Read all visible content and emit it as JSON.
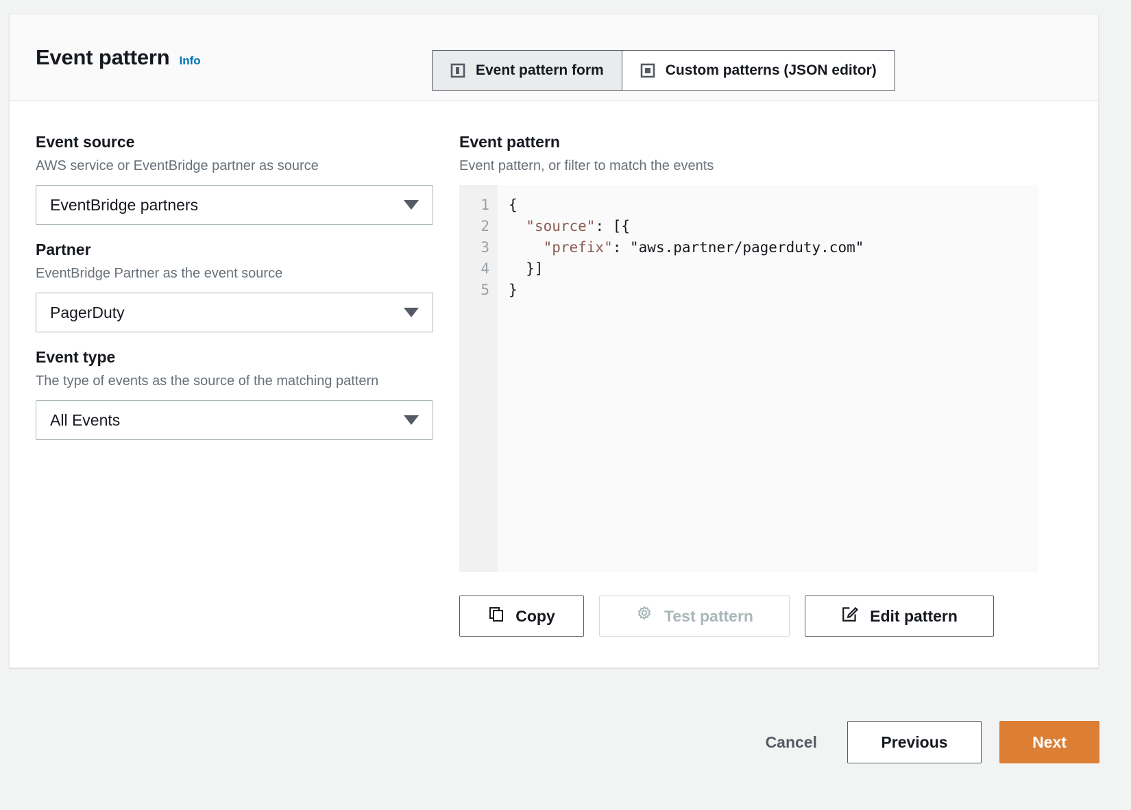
{
  "header": {
    "title": "Event pattern",
    "info_label": "Info"
  },
  "tabs": [
    {
      "label": "Event pattern form",
      "icon": "form-layout-icon",
      "active": true
    },
    {
      "label": "Custom patterns (JSON editor)",
      "icon": "json-editor-icon",
      "active": false
    }
  ],
  "form": {
    "event_source": {
      "label": "Event source",
      "description": "AWS service or EventBridge partner as source",
      "value": "EventBridge partners"
    },
    "partner": {
      "label": "Partner",
      "description": "EventBridge Partner as the event source",
      "value": "PagerDuty"
    },
    "event_type": {
      "label": "Event type",
      "description": "The type of events as the source of the matching pattern",
      "value": "All Events"
    }
  },
  "pattern": {
    "label": "Event pattern",
    "description": "Event pattern, or filter to match the events",
    "line_numbers": [
      "1",
      "2",
      "3",
      "4",
      "5"
    ],
    "code_lines": [
      {
        "text": "{"
      },
      {
        "indent": "  ",
        "key": "\"source\"",
        "rest": ": [{"
      },
      {
        "indent": "    ",
        "key": "\"prefix\"",
        "rest": ": \"aws.partner/pagerduty.com\""
      },
      {
        "text": "  }]"
      },
      {
        "text": "}"
      }
    ],
    "code_full": "{\n  \"source\": [{\n    \"prefix\": \"aws.partner/pagerduty.com\"\n  }]\n}"
  },
  "editor_actions": {
    "copy": "Copy",
    "test": "Test pattern",
    "edit": "Edit pattern"
  },
  "footer": {
    "cancel": "Cancel",
    "previous": "Previous",
    "next": "Next"
  },
  "colors": {
    "accent_orange": "#dd7e35",
    "link_blue": "#0073bb",
    "json_key": "#8b5a52",
    "border_gray": "#545b64",
    "input_border": "#aab7b8"
  }
}
